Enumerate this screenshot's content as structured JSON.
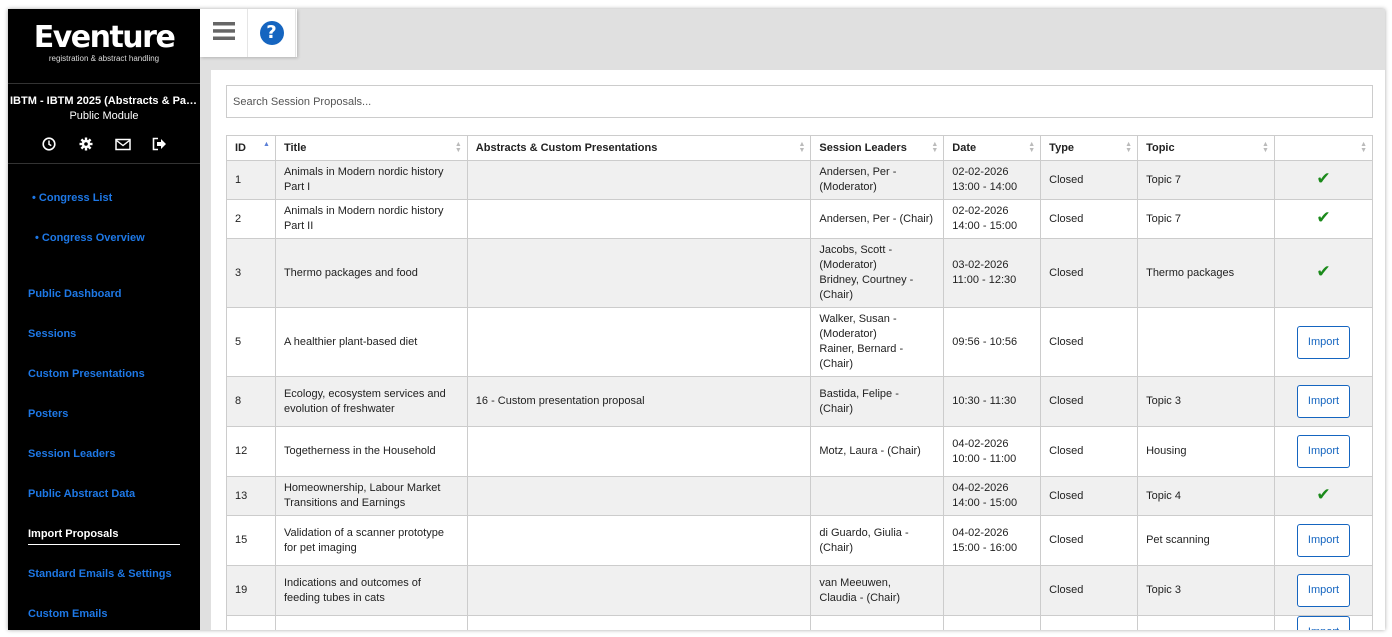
{
  "app": {
    "logo_title": "Eventure",
    "logo_subtitle": "registration & abstract handling"
  },
  "congress": {
    "title": "IBTM - IBTM 2025 (Abstracts & Par...",
    "module": "Public Module"
  },
  "sidebar_icons": [
    "clock-icon",
    "gear-icon",
    "envelope-icon",
    "logout-icon"
  ],
  "nav_sub": [
    "• Congress List",
    "• Congress Overview"
  ],
  "nav_main": [
    "Public Dashboard",
    "Sessions",
    "Custom Presentations",
    "Posters",
    "Session Leaders",
    "Public Abstract Data",
    "Import Proposals",
    "Standard Emails & Settings",
    "Custom Emails"
  ],
  "nav_active": "Import Proposals",
  "toolbar": {
    "menu_icon": "hamburger-icon",
    "help_icon": "help-icon",
    "help_glyph": "?"
  },
  "search": {
    "placeholder": "Search Session Proposals..."
  },
  "table": {
    "headers": [
      "ID",
      "Title",
      "Abstracts & Custom Presentations",
      "Session Leaders",
      "Date",
      "Type",
      "Topic",
      ""
    ],
    "sorted_column": "ID",
    "import_label": "Import",
    "rows": [
      {
        "id": "1",
        "title": "Animals in Modern nordic history Part I",
        "abstracts": "",
        "leaders": [
          "Andersen, Per -",
          "(Moderator)"
        ],
        "date": [
          "02-02-2026",
          "13:00 - 14:00"
        ],
        "type": "Closed",
        "topic": "Topic 7",
        "action": "imported"
      },
      {
        "id": "2",
        "title": "Animals in Modern nordic history Part II",
        "abstracts": "",
        "leaders": [
          "Andersen, Per - (Chair)"
        ],
        "date": [
          "02-02-2026",
          "14:00 - 15:00"
        ],
        "type": "Closed",
        "topic": "Topic 7",
        "action": "imported"
      },
      {
        "id": "3",
        "title": "Thermo packages and food",
        "abstracts": "",
        "leaders": [
          "Jacobs, Scott -",
          "(Moderator)",
          "Bridney, Courtney -",
          "(Chair)"
        ],
        "date": [
          "03-02-2026",
          "11:00 - 12:30"
        ],
        "type": "Closed",
        "topic": "Thermo packages",
        "action": "imported"
      },
      {
        "id": "5",
        "title": "A healthier plant-based diet",
        "abstracts": "",
        "leaders": [
          "Walker, Susan -",
          "(Moderator)",
          "Rainer, Bernard -",
          "(Chair)"
        ],
        "date": [
          "09:56 - 10:56"
        ],
        "type": "Closed",
        "topic": "",
        "action": "import"
      },
      {
        "id": "8",
        "title": "Ecology, ecosystem services and evolution of freshwater",
        "abstracts": "16 - Custom presentation proposal",
        "leaders": [
          "Bastida, Felipe -",
          "(Chair)"
        ],
        "date": [
          "10:30 - 11:30"
        ],
        "type": "Closed",
        "topic": "Topic 3",
        "action": "import"
      },
      {
        "id": "12",
        "title": "Togetherness in the Household",
        "abstracts": "",
        "leaders": [
          "Motz, Laura - (Chair)"
        ],
        "date": [
          "04-02-2026",
          "10:00 - 11:00"
        ],
        "type": "Closed",
        "topic": "Housing",
        "action": "import"
      },
      {
        "id": "13",
        "title": "Homeownership, Labour Market Transitions and Earnings",
        "abstracts": "",
        "leaders": [],
        "date": [
          "04-02-2026",
          "14:00 - 15:00"
        ],
        "type": "Closed",
        "topic": "Topic 4",
        "action": "imported"
      },
      {
        "id": "15",
        "title": "Validation of a scanner prototype for pet imaging",
        "abstracts": "",
        "leaders": [
          "di Guardo, Giulia -",
          "(Chair)"
        ],
        "date": [
          "04-02-2026",
          "15:00 - 16:00"
        ],
        "type": "Closed",
        "topic": "Pet scanning",
        "action": "import"
      },
      {
        "id": "19",
        "title": "Indications and outcomes of feeding tubes in cats",
        "abstracts": "",
        "leaders": [
          "van Meeuwen,",
          "Claudia - (Chair)"
        ],
        "date": [],
        "type": "Closed",
        "topic": "Topic 3",
        "action": "import"
      },
      {
        "id": "",
        "title": "",
        "abstracts": "",
        "leaders": [],
        "date": [],
        "type": "",
        "topic": "",
        "action": "import"
      }
    ]
  }
}
